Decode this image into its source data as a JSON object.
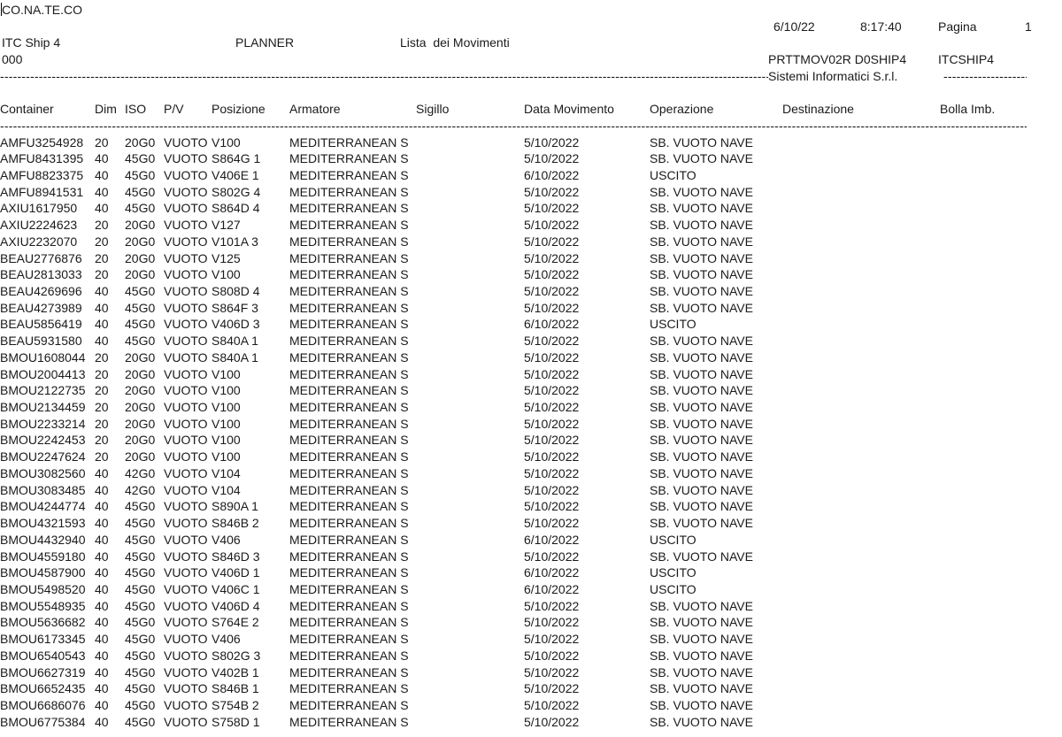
{
  "header": {
    "company": "CO.NA.TE.CO",
    "date": "6/10/22",
    "time": "8:17:40",
    "page_label": "Pagina",
    "page_number": "1",
    "system": "ITC Ship 4",
    "module": "PLANNER",
    "report_title": "Lista  dei Movimenti",
    "code": "000",
    "program": "PRTTMOV02R D0SHIP4",
    "user": "ITCSHIP4",
    "vendor": "Sistemi Informatici S.r.l."
  },
  "columns": {
    "container": "Container",
    "dim": "Dim",
    "iso": "ISO",
    "pv": "P/V",
    "posizione": "Posizione",
    "armatore": "Armatore",
    "sigillo": "Sigillo",
    "data_movimento": "Data Movimento",
    "operazione": "Operazione",
    "destinazione": "Destinazione",
    "bolla": "Bolla Imb."
  },
  "rows": [
    {
      "container": "AMFU3254928",
      "dim": "20",
      "iso": "20G0",
      "pv": "VUOTO",
      "pos": "V100",
      "armatore": "MEDITERRANEAN S",
      "data": "5/10/2022",
      "op": "SB. VUOTO NAVE"
    },
    {
      "container": "AMFU8431395",
      "dim": "40",
      "iso": "45G0",
      "pv": "VUOTO",
      "pos": "S864G 1",
      "armatore": "MEDITERRANEAN S",
      "data": "5/10/2022",
      "op": "SB. VUOTO NAVE"
    },
    {
      "container": "AMFU8823375",
      "dim": "40",
      "iso": "45G0",
      "pv": "VUOTO",
      "pos": "V406E 1",
      "armatore": "MEDITERRANEAN S",
      "data": "6/10/2022",
      "op": "USCITO"
    },
    {
      "container": "AMFU8941531",
      "dim": "40",
      "iso": "45G0",
      "pv": "VUOTO",
      "pos": "S802G 4",
      "armatore": "MEDITERRANEAN S",
      "data": "5/10/2022",
      "op": "SB. VUOTO NAVE"
    },
    {
      "container": "AXIU1617950",
      "dim": "40",
      "iso": "45G0",
      "pv": "VUOTO",
      "pos": "S864D 4",
      "armatore": "MEDITERRANEAN S",
      "data": "5/10/2022",
      "op": "SB. VUOTO NAVE"
    },
    {
      "container": "AXIU2224623",
      "dim": "20",
      "iso": "20G0",
      "pv": "VUOTO",
      "pos": "V127",
      "armatore": "MEDITERRANEAN S",
      "data": "5/10/2022",
      "op": "SB. VUOTO NAVE"
    },
    {
      "container": "AXIU2232070",
      "dim": "20",
      "iso": "20G0",
      "pv": "VUOTO",
      "pos": "V101A 3",
      "armatore": "MEDITERRANEAN S",
      "data": "5/10/2022",
      "op": "SB. VUOTO NAVE"
    },
    {
      "container": "BEAU2776876",
      "dim": "20",
      "iso": "20G0",
      "pv": "VUOTO",
      "pos": "V125",
      "armatore": "MEDITERRANEAN S",
      "data": "5/10/2022",
      "op": "SB. VUOTO NAVE"
    },
    {
      "container": "BEAU2813033",
      "dim": "20",
      "iso": "20G0",
      "pv": "VUOTO",
      "pos": "V100",
      "armatore": "MEDITERRANEAN S",
      "data": "5/10/2022",
      "op": "SB. VUOTO NAVE"
    },
    {
      "container": "BEAU4269696",
      "dim": "40",
      "iso": "45G0",
      "pv": "VUOTO",
      "pos": "S808D 4",
      "armatore": "MEDITERRANEAN S",
      "data": "5/10/2022",
      "op": "SB. VUOTO NAVE"
    },
    {
      "container": "BEAU4273989",
      "dim": "40",
      "iso": "45G0",
      "pv": "VUOTO",
      "pos": "S864F 3",
      "armatore": "MEDITERRANEAN S",
      "data": "5/10/2022",
      "op": "SB. VUOTO NAVE"
    },
    {
      "container": "BEAU5856419",
      "dim": "40",
      "iso": "45G0",
      "pv": "VUOTO",
      "pos": "V406D 3",
      "armatore": "MEDITERRANEAN S",
      "data": "6/10/2022",
      "op": "USCITO"
    },
    {
      "container": "BEAU5931580",
      "dim": "40",
      "iso": "45G0",
      "pv": "VUOTO",
      "pos": "S840A 1",
      "armatore": "MEDITERRANEAN S",
      "data": "5/10/2022",
      "op": "SB. VUOTO NAVE"
    },
    {
      "container": "BMOU1608044",
      "dim": "20",
      "iso": "20G0",
      "pv": "VUOTO",
      "pos": "S840A 1",
      "armatore": "MEDITERRANEAN S",
      "data": "5/10/2022",
      "op": "SB. VUOTO NAVE"
    },
    {
      "container": "BMOU2004413",
      "dim": "20",
      "iso": "20G0",
      "pv": "VUOTO",
      "pos": "V100",
      "armatore": "MEDITERRANEAN S",
      "data": "5/10/2022",
      "op": "SB. VUOTO NAVE"
    },
    {
      "container": "BMOU2122735",
      "dim": "20",
      "iso": "20G0",
      "pv": "VUOTO",
      "pos": "V100",
      "armatore": "MEDITERRANEAN S",
      "data": "5/10/2022",
      "op": "SB. VUOTO NAVE"
    },
    {
      "container": "BMOU2134459",
      "dim": "20",
      "iso": "20G0",
      "pv": "VUOTO",
      "pos": "V100",
      "armatore": "MEDITERRANEAN S",
      "data": "5/10/2022",
      "op": "SB. VUOTO NAVE"
    },
    {
      "container": "BMOU2233214",
      "dim": "20",
      "iso": "20G0",
      "pv": "VUOTO",
      "pos": "V100",
      "armatore": "MEDITERRANEAN S",
      "data": "5/10/2022",
      "op": "SB. VUOTO NAVE"
    },
    {
      "container": "BMOU2242453",
      "dim": "20",
      "iso": "20G0",
      "pv": "VUOTO",
      "pos": "V100",
      "armatore": "MEDITERRANEAN S",
      "data": "5/10/2022",
      "op": "SB. VUOTO NAVE"
    },
    {
      "container": "BMOU2247624",
      "dim": "20",
      "iso": "20G0",
      "pv": "VUOTO",
      "pos": "V100",
      "armatore": "MEDITERRANEAN S",
      "data": "5/10/2022",
      "op": "SB. VUOTO NAVE"
    },
    {
      "container": "BMOU3082560",
      "dim": "40",
      "iso": "42G0",
      "pv": "VUOTO",
      "pos": "V104",
      "armatore": "MEDITERRANEAN S",
      "data": "5/10/2022",
      "op": "SB. VUOTO NAVE"
    },
    {
      "container": "BMOU3083485",
      "dim": "40",
      "iso": "42G0",
      "pv": "VUOTO",
      "pos": "V104",
      "armatore": "MEDITERRANEAN S",
      "data": "5/10/2022",
      "op": "SB. VUOTO NAVE"
    },
    {
      "container": "BMOU4244774",
      "dim": "40",
      "iso": "45G0",
      "pv": "VUOTO",
      "pos": "S890A 1",
      "armatore": "MEDITERRANEAN S",
      "data": "5/10/2022",
      "op": "SB. VUOTO NAVE"
    },
    {
      "container": "BMOU4321593",
      "dim": "40",
      "iso": "45G0",
      "pv": "VUOTO",
      "pos": "S846B 2",
      "armatore": "MEDITERRANEAN S",
      "data": "5/10/2022",
      "op": "SB. VUOTO NAVE"
    },
    {
      "container": "BMOU4432940",
      "dim": "40",
      "iso": "45G0",
      "pv": "VUOTO",
      "pos": "V406",
      "armatore": "MEDITERRANEAN S",
      "data": "6/10/2022",
      "op": "USCITO"
    },
    {
      "container": "BMOU4559180",
      "dim": "40",
      "iso": "45G0",
      "pv": "VUOTO",
      "pos": "S846D 3",
      "armatore": "MEDITERRANEAN S",
      "data": "5/10/2022",
      "op": "SB. VUOTO NAVE"
    },
    {
      "container": "BMOU4587900",
      "dim": "40",
      "iso": "45G0",
      "pv": "VUOTO",
      "pos": "V406D 1",
      "armatore": "MEDITERRANEAN S",
      "data": "6/10/2022",
      "op": "USCITO"
    },
    {
      "container": "BMOU5498520",
      "dim": "40",
      "iso": "45G0",
      "pv": "VUOTO",
      "pos": "V406C 1",
      "armatore": "MEDITERRANEAN S",
      "data": "6/10/2022",
      "op": "USCITO"
    },
    {
      "container": "BMOU5548935",
      "dim": "40",
      "iso": "45G0",
      "pv": "VUOTO",
      "pos": "V406D 4",
      "armatore": "MEDITERRANEAN S",
      "data": "5/10/2022",
      "op": "SB. VUOTO NAVE"
    },
    {
      "container": "BMOU5636682",
      "dim": "40",
      "iso": "45G0",
      "pv": "VUOTO",
      "pos": "S764E 2",
      "armatore": "MEDITERRANEAN S",
      "data": "5/10/2022",
      "op": "SB. VUOTO NAVE"
    },
    {
      "container": "BMOU6173345",
      "dim": "40",
      "iso": "45G0",
      "pv": "VUOTO",
      "pos": "V406",
      "armatore": "MEDITERRANEAN S",
      "data": "5/10/2022",
      "op": "SB. VUOTO NAVE"
    },
    {
      "container": "BMOU6540543",
      "dim": "40",
      "iso": "45G0",
      "pv": "VUOTO",
      "pos": "S802G 3",
      "armatore": "MEDITERRANEAN S",
      "data": "5/10/2022",
      "op": "SB. VUOTO NAVE"
    },
    {
      "container": "BMOU6627319",
      "dim": "40",
      "iso": "45G0",
      "pv": "VUOTO",
      "pos": "V402B 1",
      "armatore": "MEDITERRANEAN S",
      "data": "5/10/2022",
      "op": "SB. VUOTO NAVE"
    },
    {
      "container": "BMOU6652435",
      "dim": "40",
      "iso": "45G0",
      "pv": "VUOTO",
      "pos": "S846B 1",
      "armatore": "MEDITERRANEAN S",
      "data": "5/10/2022",
      "op": "SB. VUOTO NAVE"
    },
    {
      "container": "BMOU6686076",
      "dim": "40",
      "iso": "45G0",
      "pv": "VUOTO",
      "pos": "S754B 2",
      "armatore": "MEDITERRANEAN S",
      "data": "5/10/2022",
      "op": "SB. VUOTO NAVE"
    },
    {
      "container": "BMOU6775384",
      "dim": "40",
      "iso": "45G0",
      "pv": "VUOTO",
      "pos": "S758D 1",
      "armatore": "MEDITERRANEAN S",
      "data": "5/10/2022",
      "op": "SB. VUOTO NAVE"
    }
  ]
}
